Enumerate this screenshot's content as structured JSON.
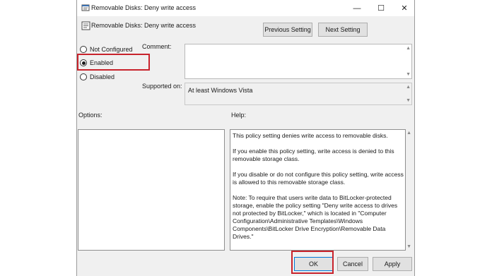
{
  "window": {
    "title": "Removable Disks: Deny write access",
    "icon": "policy-settings-icon",
    "controls": {
      "minimize": "—",
      "maximize": "☐",
      "close": "✕"
    }
  },
  "header": {
    "policy_name": "Removable Disks: Deny write access",
    "icon": "policy-setting-icon",
    "prev_label": "Previous Setting",
    "next_label": "Next Setting"
  },
  "state": {
    "options": [
      {
        "label": "Not Configured",
        "selected": false
      },
      {
        "label": "Enabled",
        "selected": true
      },
      {
        "label": "Disabled",
        "selected": false
      }
    ]
  },
  "comment": {
    "label": "Comment:",
    "value": ""
  },
  "supported": {
    "label": "Supported on:",
    "value": "At least Windows Vista"
  },
  "options_panel": {
    "label": "Options:"
  },
  "help_panel": {
    "label": "Help:",
    "paragraphs": [
      "This policy setting denies write access to removable disks.",
      "If you enable this policy setting, write access is denied to this removable storage class.",
      "If you disable or do not configure this policy setting, write access is allowed to this removable storage class.",
      "Note: To require that users write data to BitLocker-protected storage, enable the policy setting \"Deny write access to drives not protected by BitLocker,\" which is located in \"Computer Configuration\\Administrative Templates\\Windows Components\\BitLocker Drive Encryption\\Removable Data Drives.\""
    ]
  },
  "footer": {
    "ok_label": "OK",
    "cancel_label": "Cancel",
    "apply_label": "Apply"
  },
  "colors": {
    "highlight": "#c8232c",
    "dialog_bg": "#f0f0f0",
    "ok_border": "#0078d7"
  }
}
